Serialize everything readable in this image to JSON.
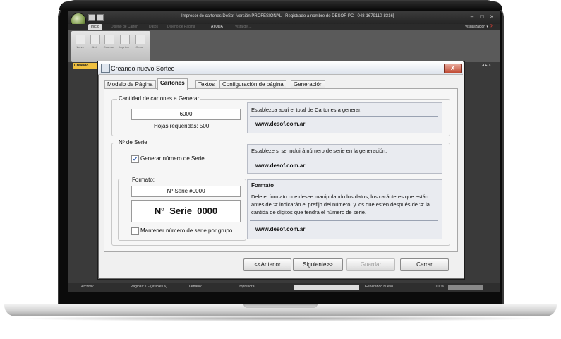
{
  "window": {
    "title": "Impresor de cartones DeSof [versión PROFESIONAL - Registrado a nombre de DESOF-PC - 048-1679110-8316]",
    "visualizacion": "Visualización ▾ ❓"
  },
  "menu": {
    "tabs": [
      "Inicio",
      "Diseño de Cartón",
      "Datos",
      "Diseño de Página",
      "AYUDA",
      "Vista de ..."
    ]
  },
  "ribbon": {
    "buttons": [
      "Nuevo",
      "Abrir",
      "Guardar",
      "Imprimir",
      "Cerrar"
    ]
  },
  "doc_tab": "Creando",
  "dock_controls": "◂ ▸ ×",
  "status": {
    "archivo": "Archivo:",
    "paginas": "Páginas: 0 - (visibles 6)",
    "tamano": "Tamaño:",
    "impresora": "Impresora:",
    "generando": "Generando nuevo...",
    "zoom": "100 %"
  },
  "dialog": {
    "title": "Creando nuevo Sorteo",
    "close": "X",
    "tabs": [
      "Modelo de Página",
      "Cartones",
      "Textos",
      "Configuración de página",
      "Generación"
    ],
    "cantidad": {
      "legend": "Cantidad de cartones a Generar",
      "value": "6000",
      "hojas": "Hojas requeridas: 500",
      "info": "Establezca aquí el total de Cartones a generar.",
      "link": "www.desof.com.ar"
    },
    "serie": {
      "legend": "Nº de Serie",
      "generar_label": "Generar número de Serie",
      "generar_checked": true,
      "info": "Estableze si se incluirá número de serie en la generación.",
      "link": "www.desof.com.ar",
      "formato_legend": "Formato:",
      "formato_value": "Nº Serie #0000",
      "preview": "Nº_Serie_0000",
      "mantener_label": "Mantener número de serie por grupo.",
      "mantener_checked": false,
      "formato_title": "Formato",
      "formato_info": "Dele el formato que desee manipulando los datos, los carácteres que están antes de '#' indicarán el prefijo del número, y los que estén después de '#' la cantida de dígitos que tendrá el número de serie.",
      "formato_link": "www.desof.com.ar"
    },
    "buttons": {
      "anterior": "<<Anterior",
      "siguiente": "Siguiente>>",
      "guardar": "Guardar",
      "cerrar": "Cerrar"
    }
  }
}
